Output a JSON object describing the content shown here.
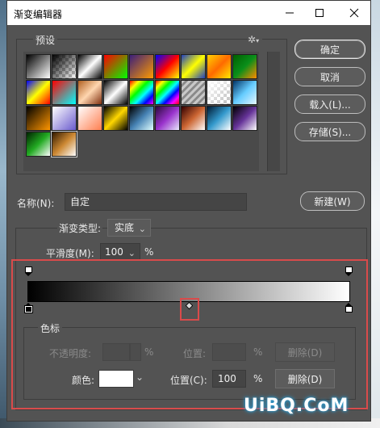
{
  "window": {
    "title": "渐变编辑器",
    "minimize_icon": "minimize-icon",
    "maximize_icon": "maximize-icon",
    "close_icon": "close-icon"
  },
  "presets": {
    "label": "预设",
    "menu_icon": "gear-icon",
    "swatches": [
      "linear-gradient(135deg,#000 0%,#fff 100%)",
      "linear-gradient(135deg,#000 0%,rgba(0,0,0,0) 100%)",
      "linear-gradient(135deg,#000 0%,#fff 50%,#000 100%)",
      "linear-gradient(135deg,#ff0000 0%,#00ff00 100%)",
      "linear-gradient(135deg,#3b1f7a 0%,#ff9a00 100%)",
      "linear-gradient(135deg,#0000ff 0%,#ff0000 50%,#ffff00 100%)",
      "linear-gradient(135deg,#1f3fbf 0%,#ffff00 50%,#1f3fbf 100%)",
      "linear-gradient(135deg,#ffd200 0%,#ff6a00 50%,#ffea00 100%)",
      "linear-gradient(135deg,#005f00 0%,#0a8f1a 50%,#ff8c00 100%)",
      "linear-gradient(135deg,#0000ff 0%,#ffff00 50%,#ff0000 100%)",
      "linear-gradient(135deg,#ff0000 0%,#00ffff 100%)",
      "linear-gradient(135deg,#b06020 0%,#ffd6b0 50%,#803010 100%)",
      "linear-gradient(135deg,#000 0%,#ffffff 50%,#000 100%)",
      "linear-gradient(135deg,#ff0000,#ffff00,#00ff00,#00ffff,#0000ff,#ff00ff)",
      "linear-gradient(135deg,#ff0000,#ffff00,#00ff00,#00ffff,#0000ff,#ff00ff,#ff0000)",
      "repeating-linear-gradient(135deg,#c8c8c8 0 3px,#8a8a8a 3px 6px)",
      "linear-gradient(135deg,#ffffff 0%,rgba(255,255,255,0) 100%)",
      "linear-gradient(135deg,#003366 0%,#66ccff 50%,#e6f7ff 100%)",
      "linear-gradient(135deg,#000 0%,#ff9600 100%)",
      "linear-gradient(135deg,#ffffff 0%,#6a5acd 100%)",
      "linear-gradient(135deg,#ffffff 0%,#ff7f50 100%)",
      "linear-gradient(135deg,#000 0%,#ffd700 50%,#000 100%)",
      "linear-gradient(135deg,#000 0%,#4682b4 50%,#e0ffff 100%)",
      "linear-gradient(135deg,#2b0a3d 0%,#9932cc 50%,#e6e6fa 100%)",
      "linear-gradient(135deg,#330000 0%,#cc6633 50%,#ffffff 100%)",
      "linear-gradient(135deg,#001a33 0%,#3399cc 50%,#ffffff 100%)",
      "linear-gradient(135deg,#000 0%,#663399 50%,#ffffff 100%)",
      "linear-gradient(135deg,#002200 0%,#22aa22 50%,#ffffff 100%)",
      "linear-gradient(135deg,#331a00 0%,#cc8833 50%,#ffffff 100%)"
    ]
  },
  "buttons": {
    "ok": "确定",
    "cancel": "取消",
    "load": "载入(L)...",
    "save": "存储(S)...",
    "new": "新建(W)"
  },
  "name": {
    "label": "名称(N):",
    "value": "自定"
  },
  "gradient_type": {
    "label": "渐变类型:",
    "value": "实底"
  },
  "smoothness": {
    "label": "平滑度(M):",
    "value": "100",
    "unit": "%"
  },
  "color_stops": {
    "group_label": "色标",
    "opacity_label": "不透明度:",
    "opacity_value": "",
    "opacity_unit": "%",
    "opacity_position_label": "位置:",
    "opacity_position_value": "",
    "opacity_position_unit": "%",
    "opacity_delete": "删除(D)",
    "color_label": "颜色:",
    "color_value": "#ffffff",
    "position_label": "位置(C):",
    "position_value": "100",
    "position_unit": "%",
    "delete": "删除(D)"
  },
  "gradient": {
    "start_color": "#000000",
    "end_color": "#ffffff",
    "midpoint_percent": 50
  },
  "watermark": "UiBQ.CoM"
}
